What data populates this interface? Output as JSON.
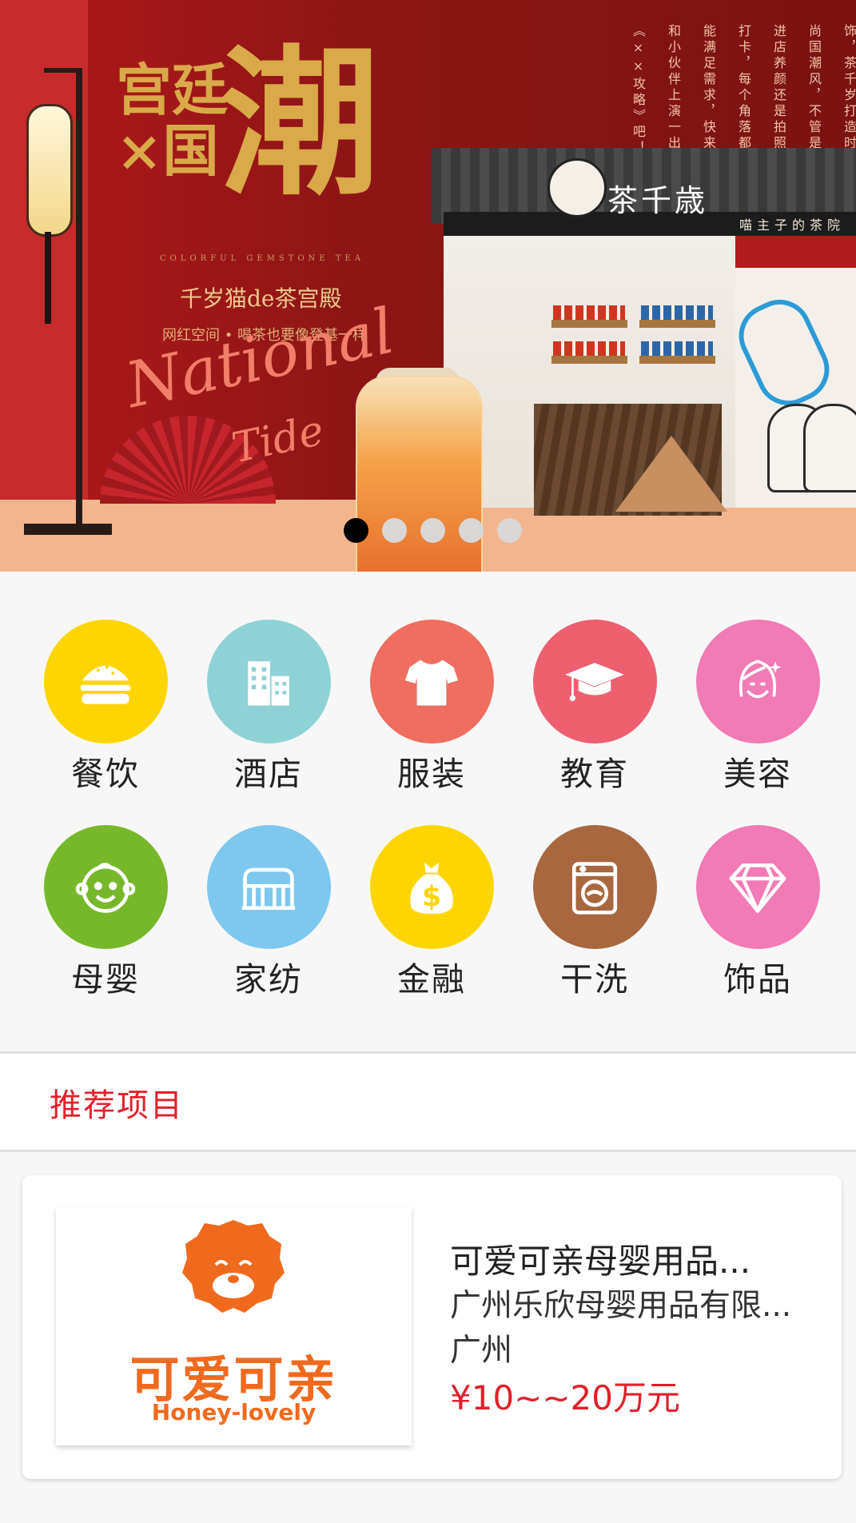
{
  "banner": {
    "headline_small": "宫廷×国",
    "headline_big": "潮",
    "gemstone": "COLORFUL GEMSTONE TEA",
    "subtitle": "千岁猫de茶宫殿",
    "tagline": "网红空间 • 喝茶也要像登基一样",
    "national": "National",
    "tide": "Tide",
    "shop_name": "茶千歳",
    "shop_slogan": "喵主子的茶院",
    "vertical_text": [
      "饰，茶千岁打造时",
      "尚国潮风，不管是",
      "进店养颜还是拍照",
      "打卡，每个角落都",
      "能满足需求，快来",
      "和小伙伴上演一出",
      "《××攻略》吧！"
    ],
    "dots_total": 5,
    "dots_active": 1
  },
  "categories": [
    {
      "label": "餐饮",
      "icon": "burger-icon",
      "color": "#ffd500"
    },
    {
      "label": "酒店",
      "icon": "building-icon",
      "color": "#8fd2d6"
    },
    {
      "label": "服装",
      "icon": "shirt-icon",
      "color": "#ef6e5f"
    },
    {
      "label": "教育",
      "icon": "graduation-cap-icon",
      "color": "#ee5f70"
    },
    {
      "label": "美容",
      "icon": "woman-face-icon",
      "color": "#f27ab5"
    },
    {
      "label": "母婴",
      "icon": "baby-face-icon",
      "color": "#77b82b"
    },
    {
      "label": "家纺",
      "icon": "bed-icon",
      "color": "#7ec8ef"
    },
    {
      "label": "金融",
      "icon": "money-bag-icon",
      "color": "#ffd500"
    },
    {
      "label": "干洗",
      "icon": "washing-machine-icon",
      "color": "#a8673e"
    },
    {
      "label": "饰品",
      "icon": "diamond-icon",
      "color": "#f27ab5"
    }
  ],
  "section": {
    "title": "推荐项目"
  },
  "project": {
    "logo_cn": "可爱可亲",
    "logo_en": "Honey-lovely",
    "title": "可爱可亲母婴用品...",
    "company": "广州乐欣母婴用品有限...",
    "city": "广州",
    "price": "¥10~~20万元",
    "brand_color": "#f06a1e"
  }
}
